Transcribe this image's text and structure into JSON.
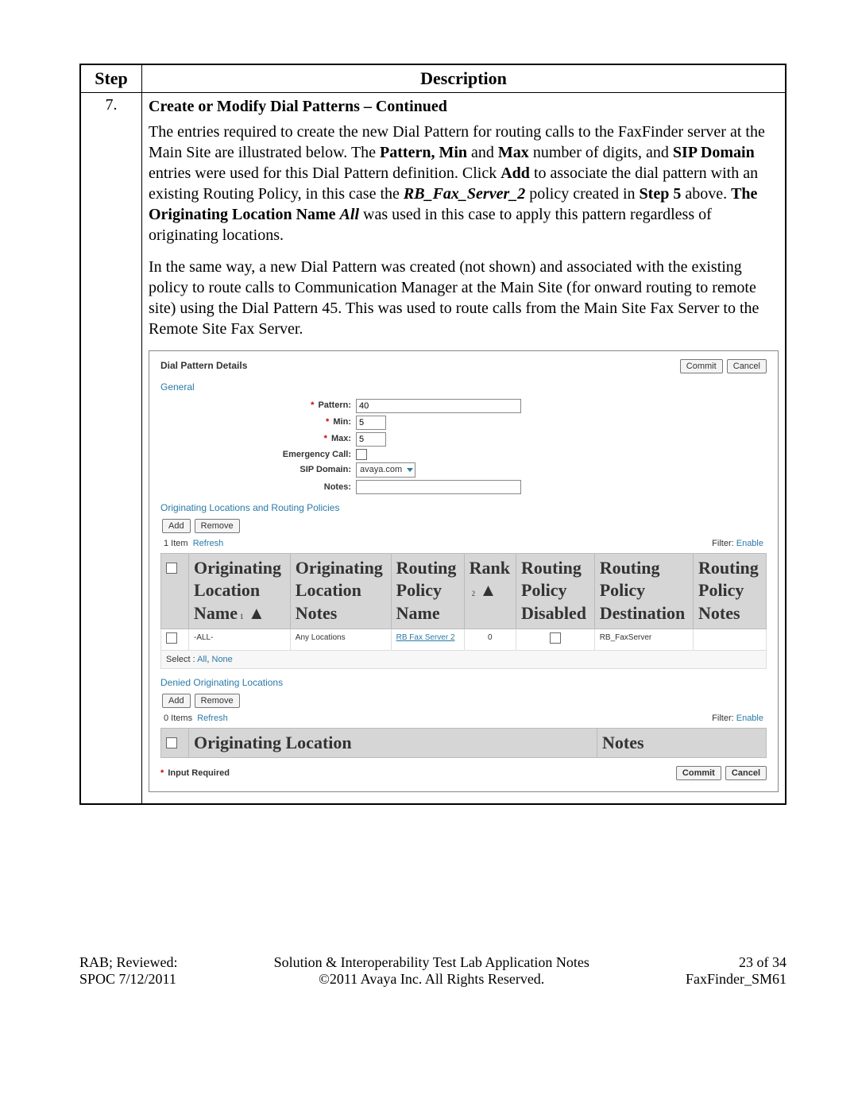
{
  "header": {
    "step": "Step",
    "description": "Description"
  },
  "row": {
    "num": "7.",
    "title": "Create or Modify Dial Patterns – Continued",
    "para1_a": "The entries required to create the new Dial Pattern for routing calls to the FaxFinder server at the Main Site are illustrated below. The ",
    "para1_b_bold": "Pattern, Min",
    "para1_c": " and ",
    "para1_d_bold": "Max",
    "para1_e": " number of digits, and ",
    "para1_f_bold": "SIP Domain",
    "para1_g": " entries were used for this Dial Pattern definition. Click ",
    "para1_h_bold": "Add",
    "para1_i": " to associate the dial pattern with an existing Routing Policy, in this case the ",
    "para1_j_ital": "RB_Fax_Server_2",
    "para1_k": " policy created in ",
    "para1_l_bold": "Step 5",
    "para1_m": " above. ",
    "para1_n_bold": "The Originating Location Name ",
    "para1_o_ital": "All",
    "para1_p": " was used in this case to apply this pattern regardless of originating locations.",
    "para2": "In the same way, a new Dial Pattern was created (not shown) and associated with the existing policy to route calls to Communication Manager at the Main Site (for onward routing to remote site) using the Dial Pattern 45. This was used to route calls from the Main Site Fax Server to the Remote Site Fax Server."
  },
  "shot": {
    "title": "Dial Pattern Details",
    "commit": "Commit",
    "cancel": "Cancel",
    "general": "General",
    "labels": {
      "pattern": "Pattern:",
      "min": "Min:",
      "max": "Max:",
      "emergency": "Emergency Call:",
      "sipdomain": "SIP Domain:",
      "notes": "Notes:"
    },
    "values": {
      "pattern": "40",
      "min": "5",
      "max": "5",
      "sipdomain": "avaya.com"
    },
    "orig_section": "Originating Locations and Routing Policies",
    "add": "Add",
    "remove": "Remove",
    "item_count": "1 Item",
    "refresh": "Refresh",
    "filter": "Filter:",
    "enable": "Enable",
    "cols": {
      "orig_name": "Originating Location Name",
      "orig_notes": "Originating Location Notes",
      "rp_name": "Routing Policy Name",
      "rank": "Rank",
      "rp_disabled": "Routing Policy Disabled",
      "rp_dest": "Routing Policy Destination",
      "rp_notes": "Routing Policy Notes"
    },
    "sort1": "1",
    "sort2": "2",
    "row1": {
      "orig_name": "-ALL-",
      "orig_notes": "Any Locations",
      "rp_name": "RB Fax Server 2",
      "rank": "0",
      "rp_dest": "RB_FaxServer"
    },
    "select_label": "Select :",
    "select_all": "All",
    "select_none": "None",
    "denied_section": "Denied Originating Locations",
    "denied_count": "0 Items",
    "denied_col1": "Originating Location",
    "denied_col2": "Notes",
    "input_required": "Input Required"
  },
  "footer": {
    "left1": "RAB; Reviewed:",
    "left2": "SPOC 7/12/2011",
    "mid1": "Solution & Interoperability Test Lab Application Notes",
    "mid2": "©2011 Avaya Inc. All Rights Reserved.",
    "right1": "23 of 34",
    "right2": "FaxFinder_SM61"
  }
}
